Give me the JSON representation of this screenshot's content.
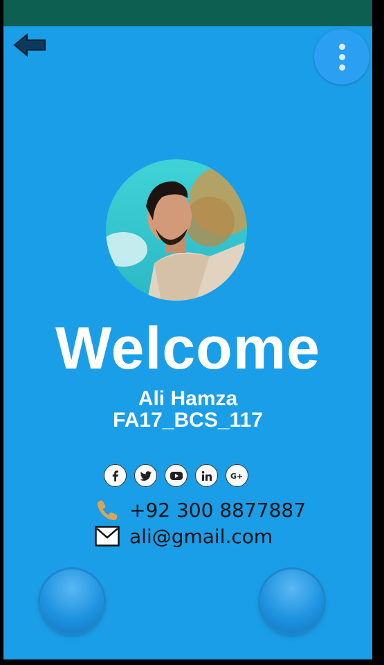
{
  "profile": {
    "greeting": "Welcome",
    "name": "Ali Hamza",
    "student_id": "FA17_BCS_117"
  },
  "contact": {
    "phone": "+92 300 8877887",
    "email": "ali@gmail.com"
  },
  "social_icons": [
    "facebook-icon",
    "twitter-icon",
    "youtube-icon",
    "linkedin-icon",
    "google-plus-icon"
  ],
  "colors": {
    "background": "#1a9ee8",
    "status_bar": "#0d5f52",
    "text_primary": "#ffffff",
    "text_contact": "#111111"
  }
}
